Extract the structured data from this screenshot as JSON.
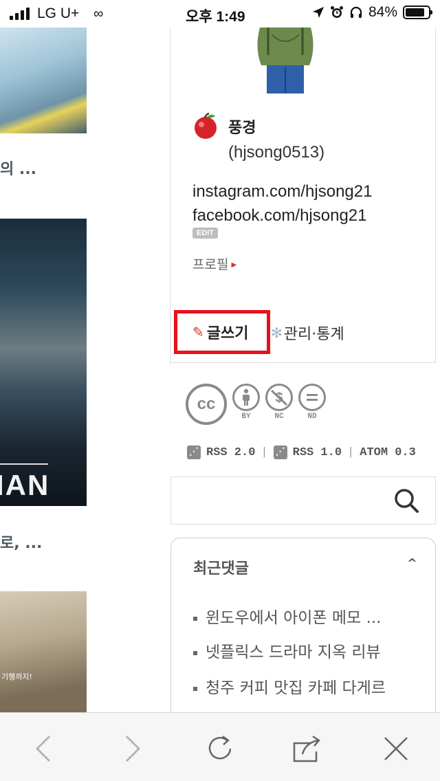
{
  "status_bar": {
    "carrier": "LG U+",
    "time": "오후 1:49",
    "battery": "84%",
    "battery_level": 0.84,
    "icons": [
      "signal-icon",
      "link-icon",
      "location-icon",
      "alarm-icon",
      "headphones-icon",
      "battery-icon"
    ]
  },
  "posts": [
    {
      "title": "의 ..."
    },
    {
      "title": "로, ...",
      "thumb_text": "IAN"
    },
    {
      "thumb_text": "기행까지!"
    }
  ],
  "profile": {
    "nickname": "풍경",
    "user_id": "(hjsong0513)",
    "bio_lines": [
      "instagram.com/hjsong21",
      "facebook.com/hjsong21"
    ],
    "edit_label": "EDIT",
    "profile_link": "프로필",
    "write_label": "글쓰기",
    "admin_label": "관리·통계"
  },
  "license": {
    "cc": "cc",
    "badges": [
      "BY",
      "NC",
      "ND"
    ]
  },
  "feeds": {
    "rss2": "RSS 2.0",
    "rss1": "RSS 1.0",
    "atom": "ATOM 0.3"
  },
  "search": {
    "placeholder": ""
  },
  "recent_comments": {
    "title": "최근댓글",
    "items": [
      "윈도우에서 아이폰 메모 ...",
      "넷플릭스 드라마 지옥 리뷰",
      "청주 커피 맛집 카페 다게르"
    ]
  },
  "colors": {
    "highlight_border": "#e8101d",
    "accent": "#d33"
  }
}
